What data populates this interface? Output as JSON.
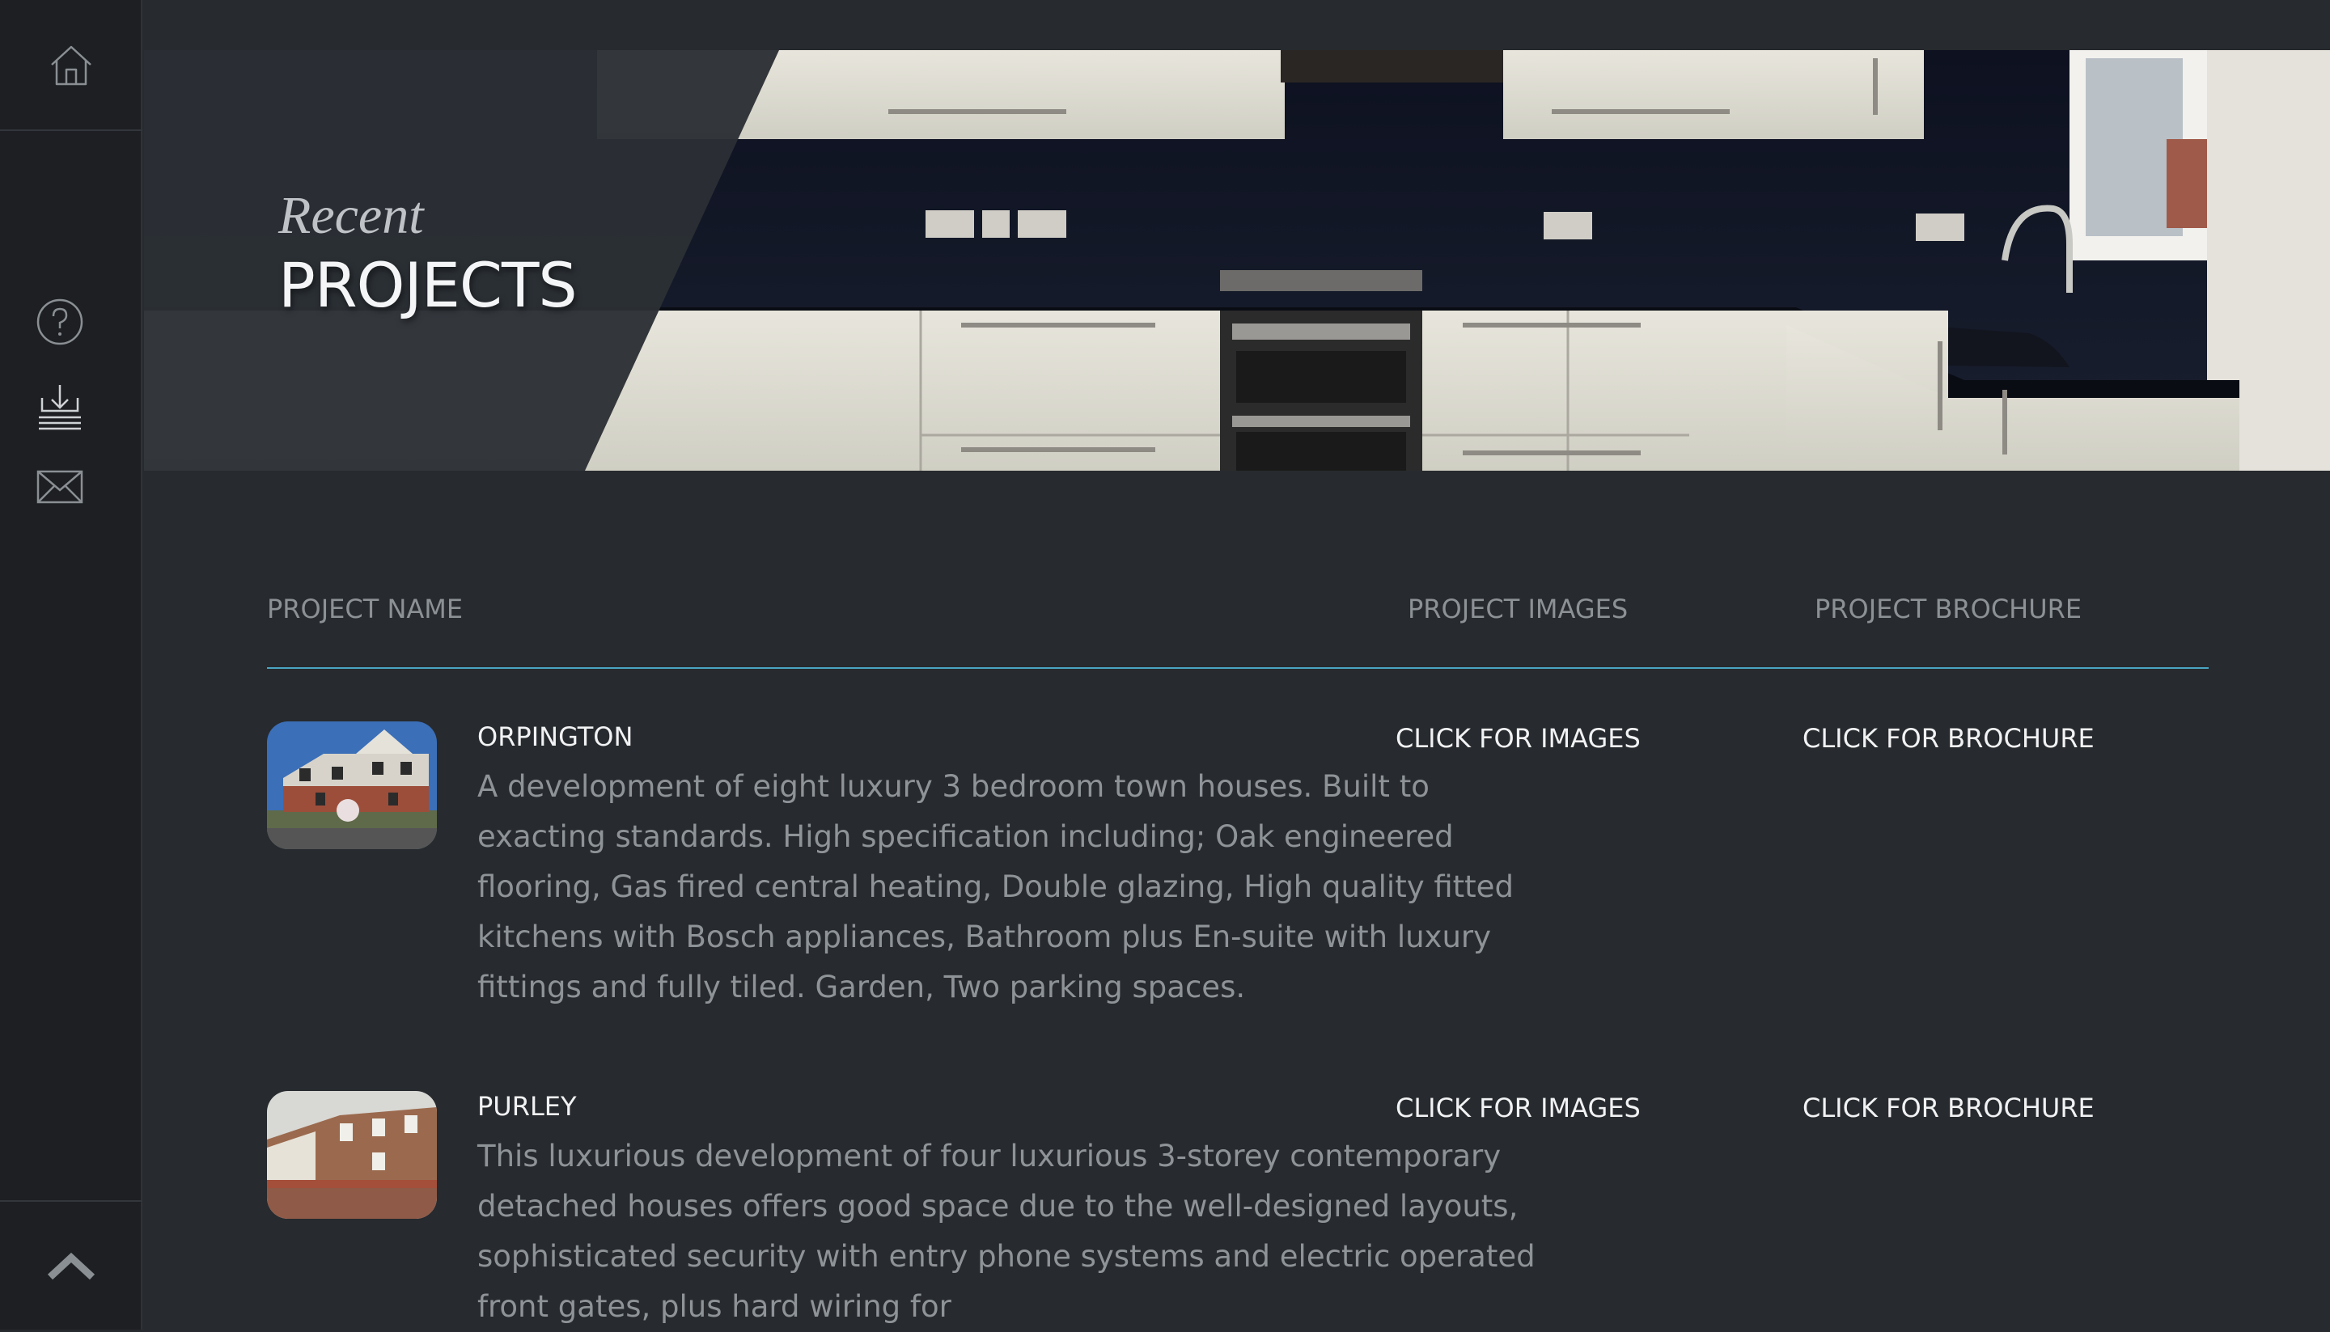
{
  "sidebar": {
    "icons": [
      "home-icon",
      "help-icon",
      "download-icon",
      "mail-icon",
      "chevron-up-icon"
    ]
  },
  "hero": {
    "title_small": "Recent",
    "title_large": "PROJECTS"
  },
  "table": {
    "headers": {
      "name": "PROJECT NAME",
      "images": "PROJECT IMAGES",
      "brochure": "PROJECT BROCHURE"
    },
    "rows": [
      {
        "name": "ORPINGTON",
        "description": "A development of eight luxury 3 bedroom town houses. Built to exacting standards. High specification including; Oak engineered flooring, Gas fired central heating, Double glazing, High quality fitted kitchens with Bosch appliances, Bathroom plus En-suite with luxury fittings and fully tiled. Garden, Two parking spaces.",
        "images_link": "CLICK FOR IMAGES",
        "brochure_link": "CLICK FOR BROCHURE"
      },
      {
        "name": "PURLEY",
        "description": "This luxurious development of four luxurious 3-storey contemporary detached houses offers good space due to the well-designed layouts, sophisticated security with entry phone systems and electric operated front gates, plus hard wiring for",
        "images_link": "CLICK FOR IMAGES",
        "brochure_link": "CLICK FOR BROCHURE"
      }
    ]
  },
  "colors": {
    "background": "#272a2e",
    "sidebar": "#1d1f22",
    "accent": "#4aa4c4"
  }
}
